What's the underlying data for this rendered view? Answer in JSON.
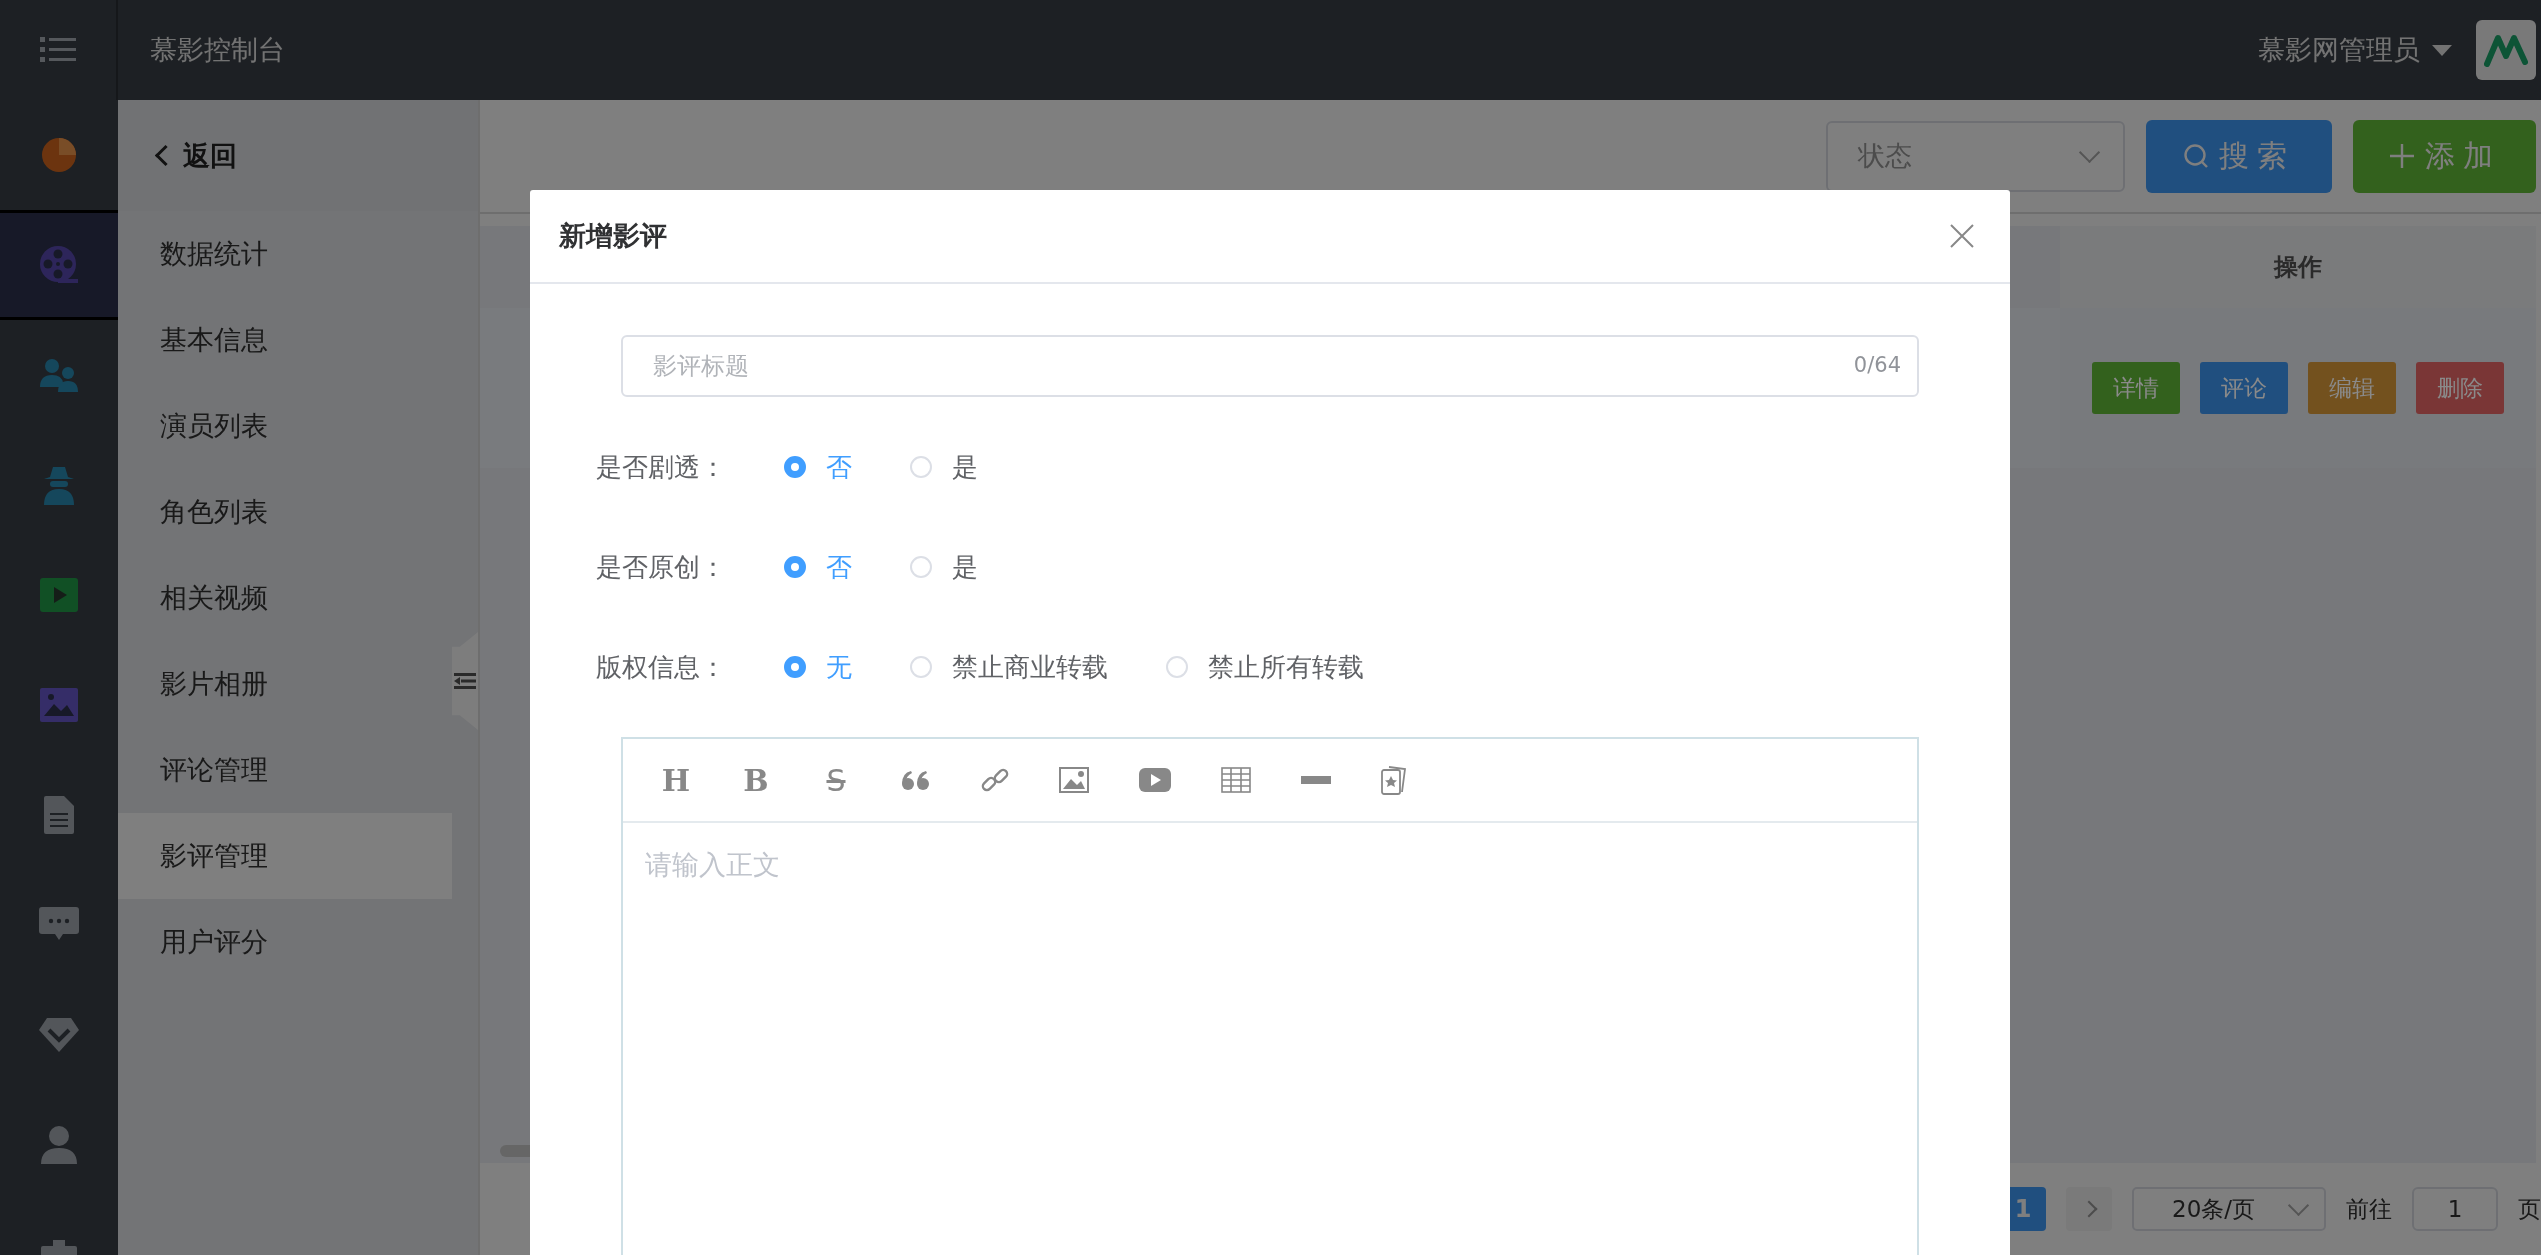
{
  "header": {
    "title": "慕影控制台",
    "user": "慕影网管理员"
  },
  "rail": [
    {
      "selected": false
    },
    {
      "selected": true
    },
    {
      "selected": false
    },
    {
      "selected": false
    },
    {
      "selected": false
    },
    {
      "selected": false
    },
    {
      "selected": false
    },
    {
      "selected": false
    },
    {
      "selected": false
    },
    {
      "selected": false
    },
    {
      "selected": false
    }
  ],
  "submenu": {
    "back": "返回",
    "items": [
      {
        "label": "数据统计",
        "selected": false
      },
      {
        "label": "基本信息",
        "selected": false
      },
      {
        "label": "演员列表",
        "selected": false
      },
      {
        "label": "角色列表",
        "selected": false
      },
      {
        "label": "相关视频",
        "selected": false
      },
      {
        "label": "影片相册",
        "selected": false
      },
      {
        "label": "评论管理",
        "selected": false
      },
      {
        "label": "影评管理",
        "selected": true
      },
      {
        "label": "用户评分",
        "selected": false
      }
    ]
  },
  "toolbar": {
    "status": {
      "placeholder": "状态"
    },
    "search": "搜索",
    "add": "添加"
  },
  "table": {
    "columns": [
      "操作"
    ],
    "actions": [
      {
        "label": "详情",
        "color": "#33611d"
      },
      {
        "label": "评论",
        "color": "#204f7f"
      },
      {
        "label": "编辑",
        "color": "#73511e"
      },
      {
        "label": "删除",
        "color": "#7a3636"
      }
    ]
  },
  "pagination": {
    "pages": [
      {
        "label": "1",
        "selected": true
      }
    ],
    "page_size": "20条/页",
    "goto_label": "前往",
    "goto_value": "1",
    "page_suffix": "页"
  },
  "dialog": {
    "title": "新增影评",
    "title_field": {
      "placeholder": "影评标题",
      "counter": "0/64"
    },
    "radio_groups": [
      {
        "label": "是否剧透：",
        "options": [
          {
            "label": "否",
            "selected": true
          },
          {
            "label": "是",
            "selected": false
          }
        ]
      },
      {
        "label": "是否原创：",
        "options": [
          {
            "label": "否",
            "selected": true
          },
          {
            "label": "是",
            "selected": false
          }
        ]
      },
      {
        "label": "版权信息：",
        "options": [
          {
            "label": "无",
            "selected": true
          },
          {
            "label": "禁止商业转载",
            "selected": false
          },
          {
            "label": "禁止所有转载",
            "selected": false
          }
        ]
      }
    ],
    "editor": {
      "tools": [
        {
          "kind": "heading",
          "glyph": "H"
        },
        {
          "kind": "bold",
          "glyph": "B"
        },
        {
          "kind": "strike",
          "glyph": "S"
        },
        {
          "kind": "quote"
        },
        {
          "kind": "link"
        },
        {
          "kind": "image"
        },
        {
          "kind": "video"
        },
        {
          "kind": "table"
        },
        {
          "kind": "rule"
        },
        {
          "kind": "card"
        }
      ],
      "placeholder": "请输入正文"
    }
  }
}
